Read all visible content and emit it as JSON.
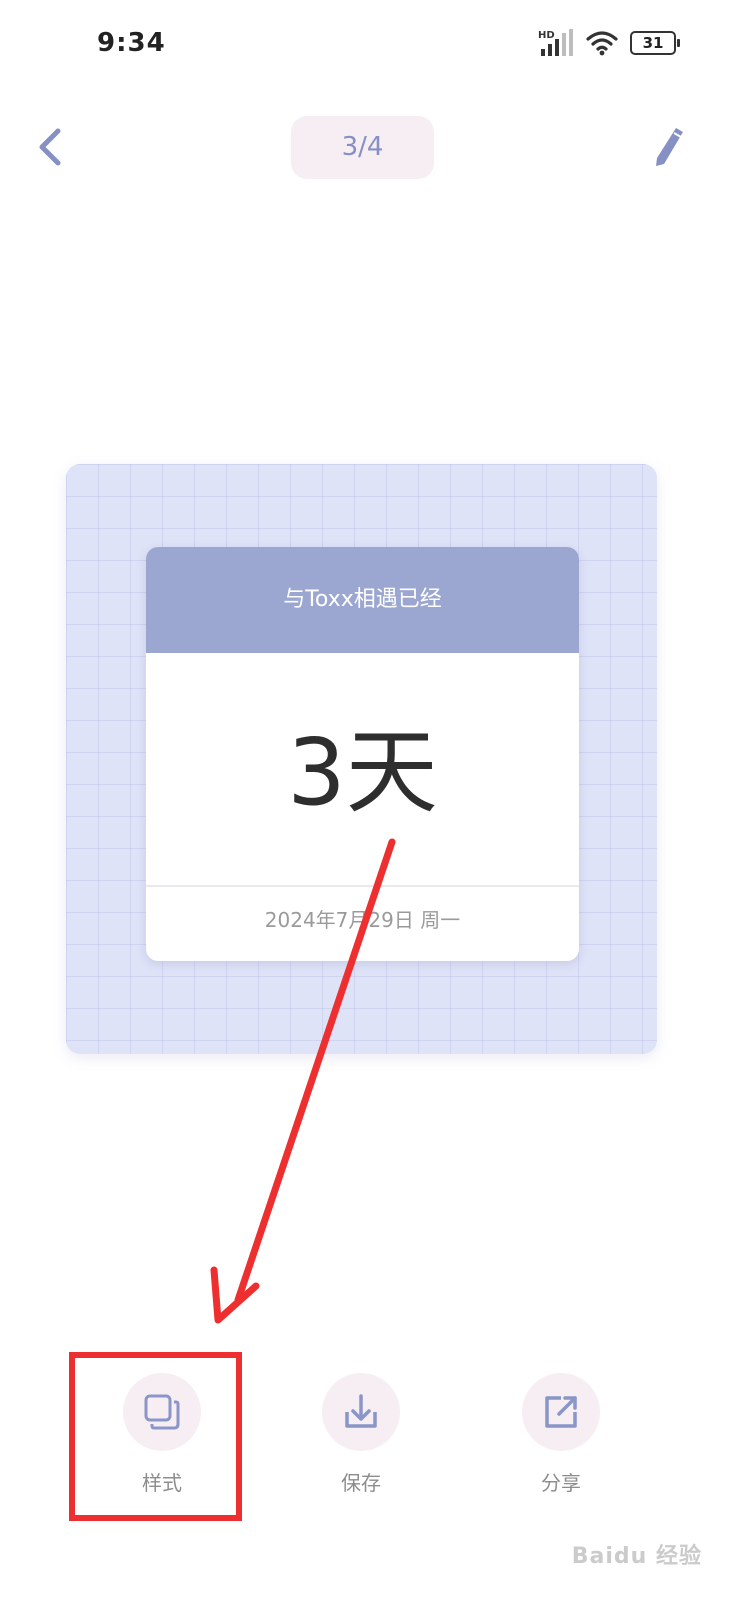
{
  "status_bar": {
    "time": "9:34",
    "battery": "31",
    "network_label": "HD"
  },
  "header": {
    "page_indicator": "3/4"
  },
  "card": {
    "title": "与Toxx相遇已经",
    "value": "3天",
    "date": "2024年7月29日 周一"
  },
  "actions": [
    {
      "label": "样式",
      "icon": "style-layers-icon"
    },
    {
      "label": "保存",
      "icon": "download-icon"
    },
    {
      "label": "分享",
      "icon": "share-icon"
    }
  ],
  "colors": {
    "accent": "#8590c5",
    "card_header": "#9ba7d1",
    "pill_bg": "#f7eef3",
    "highlight": "#ee2f2f"
  },
  "watermark": "Baidu 经验"
}
